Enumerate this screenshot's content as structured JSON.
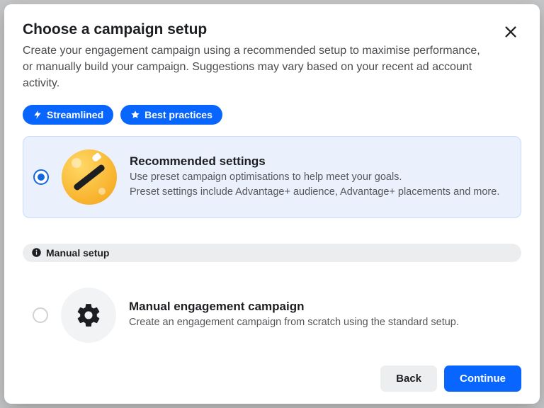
{
  "header": {
    "title": "Choose a campaign setup",
    "subtitle": "Create your engagement campaign using a recommended setup to maximise performance, or manually build your campaign. Suggestions may vary based on your recent ad account activity."
  },
  "badges": {
    "streamlined": "Streamlined",
    "best_practices": "Best practices"
  },
  "options": {
    "recommended": {
      "title": "Recommended settings",
      "line1": "Use preset campaign optimisations to help meet your goals.",
      "line2": "Preset settings include Advantage+ audience, Advantage+ placements and more.",
      "selected": true
    },
    "manual_section_label": "Manual setup",
    "manual": {
      "title": "Manual engagement campaign",
      "desc": "Create an engagement campaign from scratch using the standard setup.",
      "selected": false
    }
  },
  "footer": {
    "back": "Back",
    "continue": "Continue"
  }
}
